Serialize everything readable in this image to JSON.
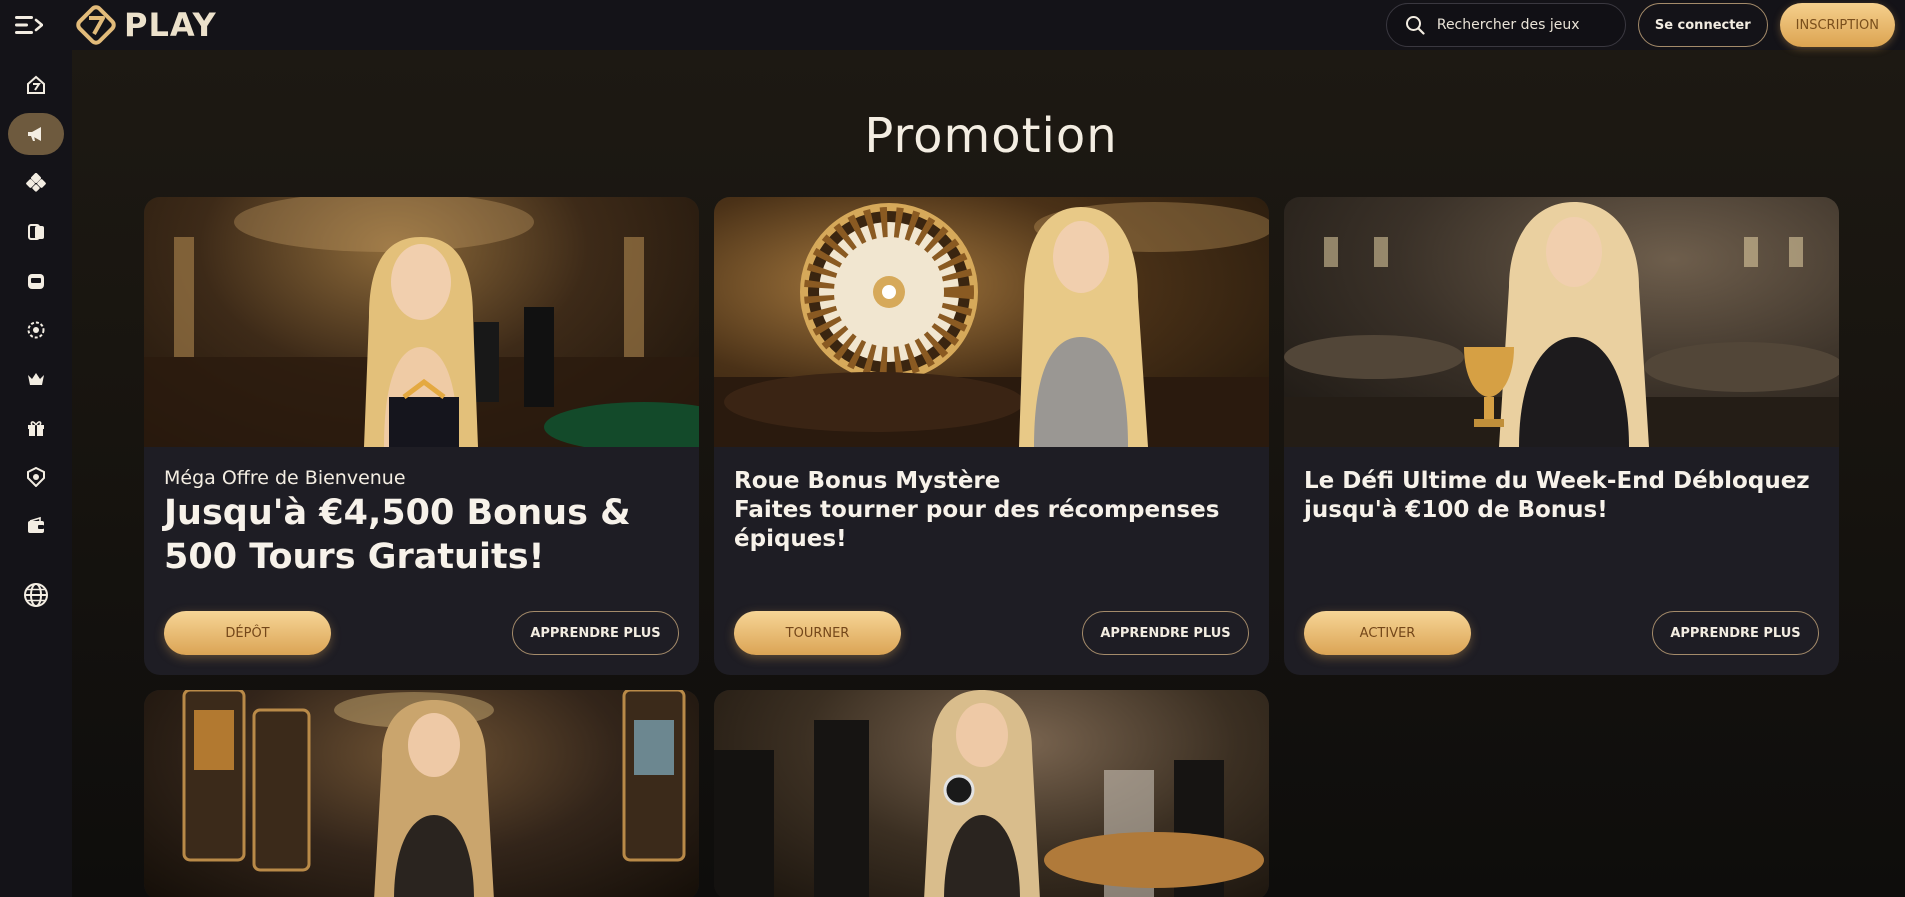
{
  "header": {
    "logo_text": "PLAY",
    "search_placeholder": "Rechercher des jeux",
    "login_label": "Se connecter",
    "signup_label": "INSCRIPTION"
  },
  "sidebar": {
    "items": [
      {
        "icon": "home-icon",
        "active": false
      },
      {
        "icon": "megaphone-icon",
        "active": true
      },
      {
        "icon": "dice-icon",
        "active": false
      },
      {
        "icon": "cards-icon",
        "active": false
      },
      {
        "icon": "slot-machine-icon",
        "active": false
      },
      {
        "icon": "roulette-icon",
        "active": false
      },
      {
        "icon": "crown-icon",
        "active": false
      },
      {
        "icon": "gift-icon",
        "active": false
      },
      {
        "icon": "vip-icon",
        "active": false
      },
      {
        "icon": "wallet-icon",
        "active": false
      }
    ],
    "language_icon": "globe-icon"
  },
  "main": {
    "title": "Promotion",
    "cards": [
      {
        "subtitle": "Méga Offre de Bienvenue",
        "headline_line1": "Jusqu'à €4,500 Bonus &",
        "headline_line2": "500 Tours Gratuits!",
        "primary_label": "DÉPÔT",
        "secondary_label": "APPRENDRE PLUS"
      },
      {
        "headline_line1": "Roue Bonus Mystère",
        "headline_line2": "Faites tourner pour des récompenses",
        "headline_line3": "épiques!",
        "primary_label": "TOURNER",
        "secondary_label": "APPRENDRE PLUS"
      },
      {
        "headline_line1": "Le Défi Ultime du Week-End Débloquez",
        "headline_line2": "jusqu'à €100 de Bonus!",
        "primary_label": "ACTIVER",
        "secondary_label": "APPRENDRE PLUS"
      }
    ]
  },
  "colors": {
    "accent_gold": "#dca451",
    "background": "#0d0c0f",
    "card": "#1e1d24"
  }
}
